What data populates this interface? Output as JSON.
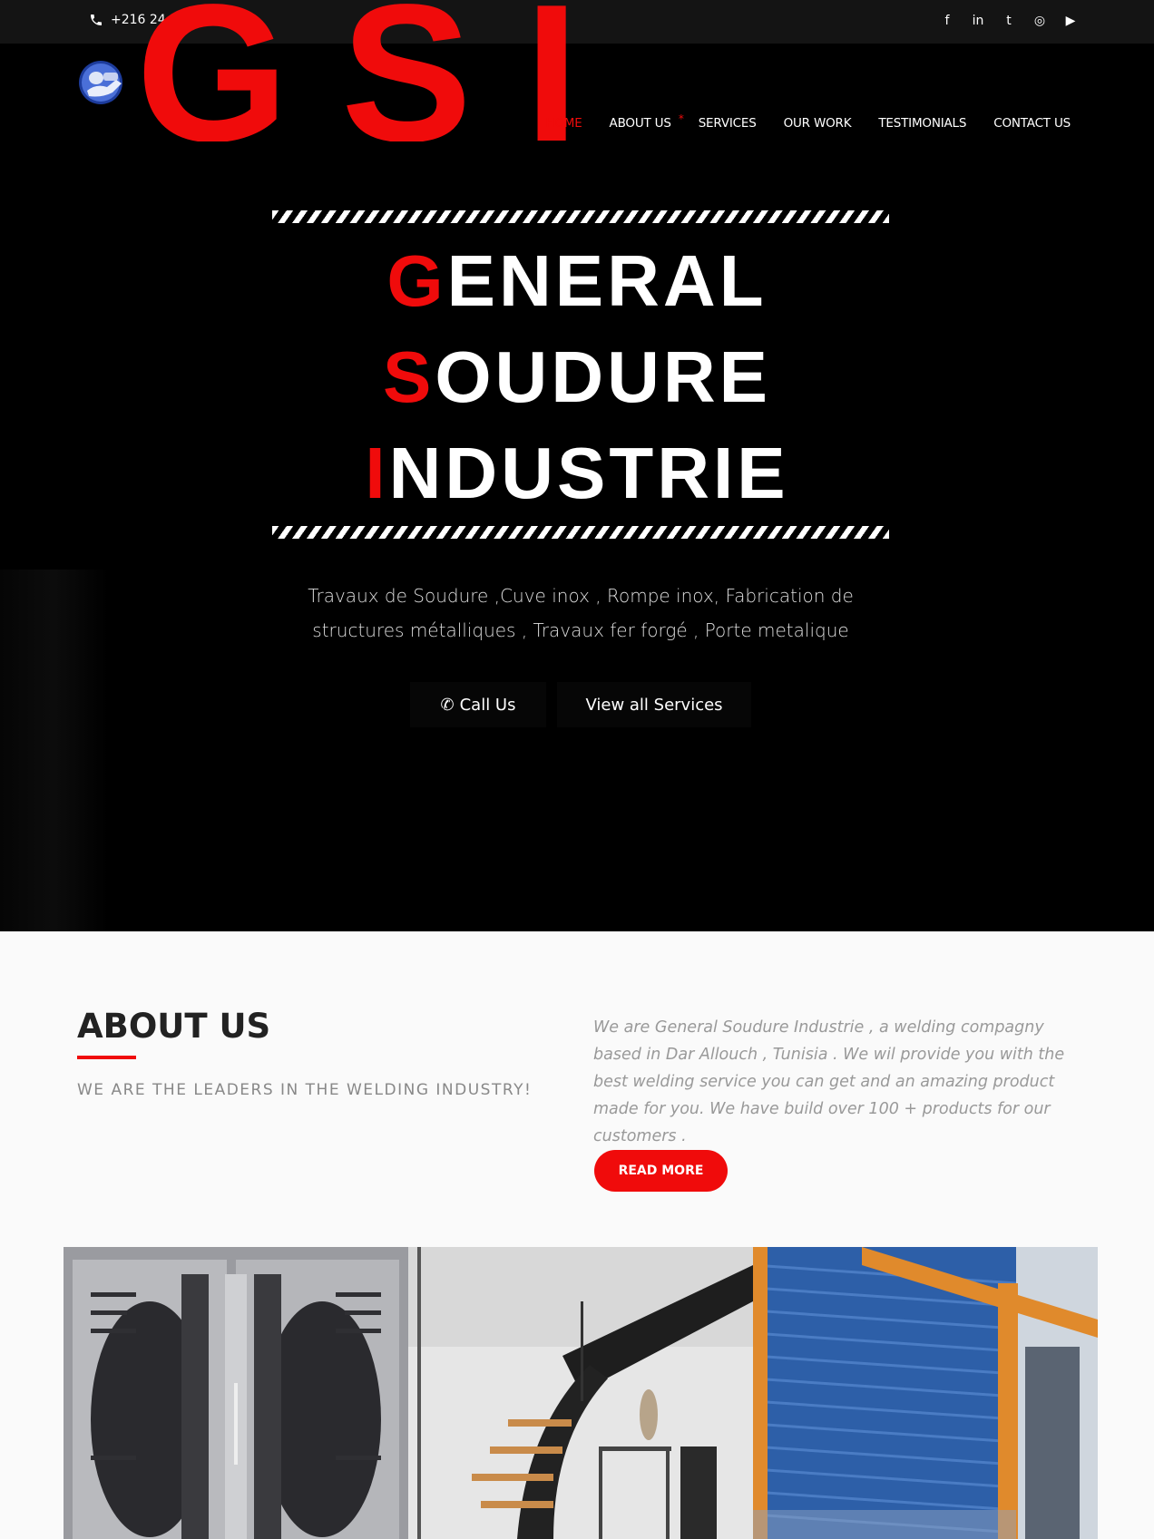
{
  "topbar": {
    "phone": "+216 24 565 980",
    "socials": [
      {
        "icon": "facebook-icon",
        "glyph": "f"
      },
      {
        "icon": "linkedin-icon",
        "glyph": "in"
      },
      {
        "icon": "twitter-icon",
        "glyph": "t"
      },
      {
        "icon": "instagram-icon",
        "glyph": "◎"
      },
      {
        "icon": "youtube-icon",
        "glyph": "▶"
      }
    ]
  },
  "header": {
    "logo_text": "GSI",
    "nav": [
      {
        "label": "HOME",
        "active": true
      },
      {
        "label": "ABOUT US",
        "dot": "*"
      },
      {
        "label": "SERVICES"
      },
      {
        "label": "OUR WORK"
      },
      {
        "label": "TESTIMONIALS"
      },
      {
        "label": "CONTACT US"
      }
    ]
  },
  "hero": {
    "line1_first": "G",
    "line1_rest": "ENERAL",
    "line2_first": "S",
    "line2_rest": "OUDURE",
    "line3_first": "I",
    "line3_rest": "NDUSTRIE",
    "subtitle": "Travaux de Soudure ,Cuve inox , Rompe inox, Fabrication de structures métalliques , Travaux fer forgé , Porte metalique",
    "call_label": "Call Us",
    "services_label": "View all Services"
  },
  "about": {
    "title": "ABOUT US",
    "tagline": "WE ARE THE LEADERS IN THE WELDING INDUSTRY!",
    "text": "We are General Soudure Industrie , a welding compagny based in Dar Allouch , Tunisia . We wil provide you with the best welding service you can get and an amazing product made for you. We have build over 100 + products for our customers .",
    "button": "READ MORE"
  },
  "colors": {
    "accent": "#f00b0b",
    "dark": "#000000"
  }
}
